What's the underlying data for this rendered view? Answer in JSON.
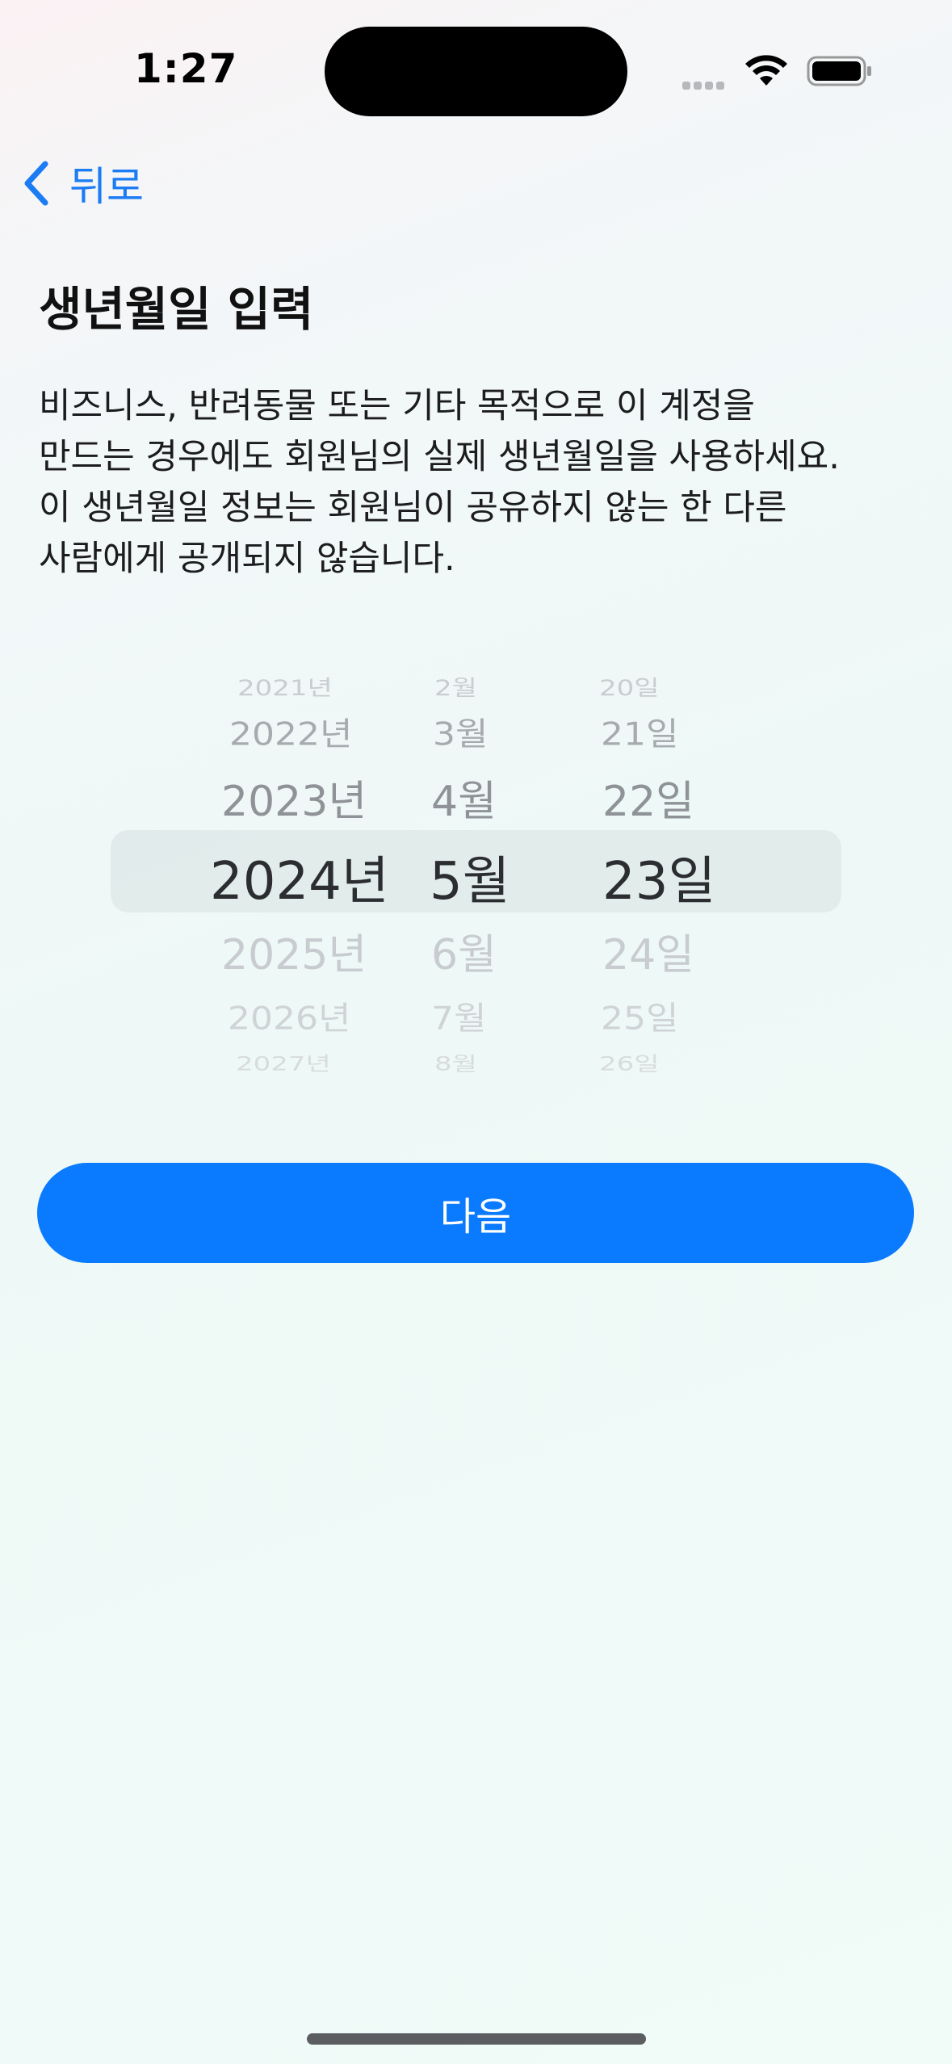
{
  "status_bar": {
    "time": "1:27"
  },
  "nav": {
    "back_label": "뒤로",
    "back_icon": "chevron-left-icon"
  },
  "header": {
    "title": "생년월일 입력"
  },
  "description": {
    "lines": [
      "비즈니스, 반려동물 또는 기타 목적으로 이 계정을",
      "만드는 경우에도 회원님의 실제 생년월일을 사용하세요.",
      "이 생년월일 정보는 회원님이 공유하지 않는 한 다른",
      "사람에게 공개되지 않습니다."
    ]
  },
  "picker": {
    "rows": [
      {
        "year": "2021년",
        "month": "2월",
        "day": "20일"
      },
      {
        "year": "2022년",
        "month": "3월",
        "day": "21일"
      },
      {
        "year": "2023년",
        "month": "4월",
        "day": "22일"
      },
      {
        "year": "2024년",
        "month": "5월",
        "day": "23일"
      },
      {
        "year": "2025년",
        "month": "6월",
        "day": "24일"
      },
      {
        "year": "2026년",
        "month": "7월",
        "day": "25일"
      },
      {
        "year": "2027년",
        "month": "8월",
        "day": "26일"
      }
    ],
    "selected": {
      "year": "2024년",
      "month": "5월",
      "day": "23일"
    }
  },
  "actions": {
    "next_label": "다음"
  },
  "colors": {
    "accent": "#0a7aff",
    "link": "#1b7cf3"
  }
}
